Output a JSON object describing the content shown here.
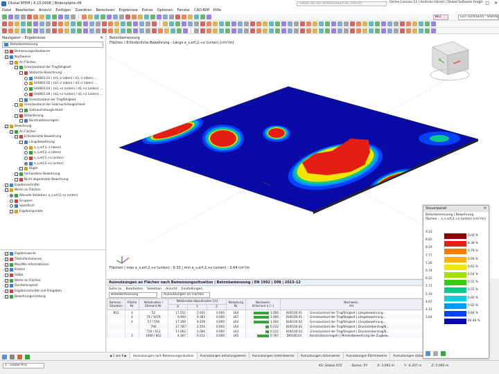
{
  "titlebar": {
    "title": "Dlubal RFEM | 6.15.0008 | Bodenplatte.rf6",
    "search_placeholder": "Geben Sie ein Schlüsselwort ein (Alt+Q)",
    "license": "Online License 12 | Andreas Hörold | Dlubal Software GmbH",
    "min": "–",
    "max": "□",
    "close": "✕"
  },
  "menu": [
    "Datei",
    "Bearbeiten",
    "Ansicht",
    "Einfügen",
    "Zuordnen",
    "Berechnen",
    "Ergebnisse",
    "Extras",
    "Optionen",
    "Fenster",
    "CAD-BIM",
    "Hilfe"
  ],
  "toolbar": {
    "lc_code": "BE1",
    "lc_combo": "GZT (STR/GEO) - Ständig und v...",
    "axis_combo": "1 - Global XYZ"
  },
  "navigator": {
    "title": "Navigator - Ergebnisse",
    "combo": "Betonbemessung",
    "items": [
      {
        "label": "Bemessungssituationen",
        "level": 0,
        "exp": "›",
        "check": "✓"
      },
      {
        "label": "Nachweise",
        "level": 0,
        "exp": "⌄",
        "check": "✓"
      },
      {
        "label": "An Flächen",
        "level": 1,
        "exp": "⌄",
        "check": "✓"
      },
      {
        "label": "Grenzzustand der Tragfähigkeit",
        "level": 2,
        "exp": "⌄",
        "check": ""
      },
      {
        "label": "Statische Berechnung",
        "level": 3,
        "exp": "⌄",
        "check": ""
      },
      {
        "label": "SA0601.01 | (σ1,-z (oben) / σ1,-z (oben) ...",
        "level": 4,
        "radio": true
      },
      {
        "label": "SA0601.02 | (σ2,-z (oben) / σ2,-z (oben) ...",
        "level": 4,
        "radio": true
      },
      {
        "label": "SA0601.03 | (σ1,+z (unten) / σ1,+z (unten) ...",
        "level": 4,
        "radio": true
      },
      {
        "label": "SA0601.04 | (σ2,+z (unten) / σ2,+z (unten) ...",
        "level": 4,
        "radio": true
      },
      {
        "label": "Grenzzustand der Tragfähigkeit",
        "level": 3,
        "exp": "›",
        "check": ""
      },
      {
        "label": "Grenzzustand der Gebrauchstauglichkeit",
        "level": 2,
        "exp": "⌄",
        "check": ""
      },
      {
        "label": "Gebrauchstauglichkeit",
        "level": 3,
        "exp": "›",
        "check": ""
      },
      {
        "label": "Detaillierung",
        "level": 2,
        "exp": "⌄",
        "check": ""
      },
      {
        "label": "Konstruktionsregeln",
        "level": 3,
        "exp": "",
        "check": ""
      },
      {
        "label": "Bewehrung",
        "level": 0,
        "exp": "⌄",
        "check": "✓"
      },
      {
        "label": "An Flächen",
        "level": 1,
        "exp": "⌄",
        "check": "✓"
      },
      {
        "label": "Erforderliche Bewehrung",
        "level": 2,
        "exp": "⌄",
        "check": "✓"
      },
      {
        "label": "Längsbewehrung",
        "level": 3,
        "exp": "⌄",
        "check": ""
      },
      {
        "label": "a_s,erf,1,-z (oben)",
        "level": 4,
        "radio": true
      },
      {
        "label": "a_s,erf,2,-z (oben)",
        "level": 4,
        "radio": true
      },
      {
        "label": "a_s,erf,1,+z (unten)",
        "level": 4,
        "radio": true
      },
      {
        "label": "a_s,erf,2,+z (unten)",
        "level": 4,
        "radio": true,
        "on": true
      },
      {
        "label": "Bügel",
        "level": 3,
        "exp": "›",
        "check": ""
      },
      {
        "label": "Vorhandene Bewehrung",
        "level": 2,
        "exp": "›",
        "check": ""
      },
      {
        "label": "Nicht abgedeckte Bewehrung",
        "level": 2,
        "exp": "›",
        "check": ""
      },
      {
        "label": "Ergebnisschnitte",
        "level": 0,
        "exp": "›",
        "check": ""
      },
      {
        "label": "Werte an Flächen",
        "level": 0,
        "exp": "⌄",
        "check": "✓"
      },
      {
        "label": "Aktuelle Selektion: a_s,erf,2,+z (unten)",
        "level": 1,
        "exp": "›",
        "radio": true,
        "on": true
      },
      {
        "label": "Gruppen",
        "level": 1,
        "exp": "›",
        "radio": true
      },
      {
        "label": "Spezifisch",
        "level": 1,
        "exp": "›",
        "radio": true
      },
      {
        "label": "Ergebnispunkte",
        "level": 1,
        "exp": "",
        "check": ""
      }
    ],
    "lower_items": [
      {
        "label": "Ergebniswerte",
        "check": "✓"
      },
      {
        "label": "Titelinformationen",
        "check": "✓"
      },
      {
        "label": "Max/Min-Informationen",
        "check": "✓"
      },
      {
        "label": "Knoten",
        "check": "✓"
      },
      {
        "label": "Stäbe",
        "check": ""
      },
      {
        "label": "Werte an Flächen",
        "check": "✓"
      },
      {
        "label": "Darstellungsart",
        "check": "✓"
      },
      {
        "label": "Ergebnisschnitte und Freigaben",
        "check": "✓"
      },
      {
        "label": "Bewehrungsrichtung",
        "check": "✓"
      }
    ]
  },
  "viewport": {
    "head1": "Betonbemessung",
    "head2": "Flächen | Erforderliche Bewehrung - Längs a_s,erf,2,+z (unten) [cm²/m]",
    "foot": "Flächen | max a_s,erf,2,+z (unten) : 9.33 | min a_s,erf,2,+z (unten) : 3.64 cm²/m",
    "cube_label": "-Y"
  },
  "results": {
    "title": "Ausnutzungen an Flächen nach Bemessungssituation | Betonbemessung | EN 1992 | DIN | 2015-12",
    "menu": [
      "Gehe zu",
      "Bearbeiten",
      "Selektion",
      "Ansicht",
      "Einstellungen"
    ],
    "combo1": "Betonbemessung",
    "combo2": "Ausnutzungen an Flächen",
    "headers": [
      "Bemess.-\nSituation",
      "Fläche\nNr.",
      "Netzknoten /\nElement Nr.",
      "X",
      "Y",
      "Z",
      "Belastung\nNr.",
      "Nachweis-\nKriterium η [--]",
      "Nachweis-\nArt",
      ""
    ],
    "group_header": "Netzknoten-Koordinaten [m]",
    "rows": [
      [
        "BS1",
        "4",
        "52",
        "17.552",
        "2.005",
        "0.000",
        "LK4",
        "1.000",
        "BU0100.01",
        "Grenzzustand der Tragfähigkeit | Längsbewehrung..."
      ],
      [
        "",
        "4",
        "74 / 1079",
        "0.400",
        "9.383",
        "0.000",
        "LK7",
        "1.000",
        "BU0100.01",
        "Grenzzustand der Tragfähigkeit | Längsbewehrung..."
      ],
      [
        "",
        "4",
        "57 / 556",
        "17.300",
        "9.259",
        "0.000",
        "LK4",
        "1.000",
        "BU0100.02",
        "Grenzzustand der Tragfähigkeit | Längsbewehrung..."
      ],
      [
        "",
        "",
        "790",
        "17.787",
        "2.554",
        "0.000",
        "LK3",
        "0.232",
        "BU0100.01",
        "Grenzzustand der Tragfähigkeit | Druckstrebentragfä..."
      ],
      [
        "",
        "",
        "720 / 613",
        "17.062",
        "2.066",
        "0.000",
        "LK3",
        "0.222",
        "BU0100.02",
        "Grenzzustand der Tragfähigkeit | Druckstrebentragfä..."
      ],
      [
        "",
        "3",
        "1000 / 852",
        "4.307",
        "0.212",
        "0.000",
        "LK5",
        "0.767",
        "DI0100.01",
        "Konstruktionsregeln | Mindestbewehrung der Zugbew..."
      ]
    ],
    "pager": "1 von 6",
    "tabs": [
      "Ausnutzungen nach Bemessungssituation",
      "Ausnutzungen belastungsweise",
      "Ausnutzungen materialweise",
      "Ausnutzungen dickenweise",
      "Ausnutzungen flächenweise",
      "Ausnutzungen stabweise"
    ]
  },
  "control_panel": {
    "title": "Steuerpanel",
    "sub": "Betonbemessung | Bewehrung flächen... a_s,erf,2,+z (unten) [cm²/m]",
    "legend": [
      {
        "value": "9.33",
        "color": "#8b0000",
        "pct": "0.00 %"
      },
      {
        "value": "8.81",
        "color": "#e41e12",
        "pct": "8.38 %"
      },
      {
        "value": "8.29",
        "color": "#ff7a00",
        "pct": "0.78 %"
      },
      {
        "value": "7.77",
        "color": "#ffb000",
        "pct": "0.69 %"
      },
      {
        "value": "7.26",
        "color": "#f2e600",
        "pct": "0.61 %"
      },
      {
        "value": "6.74",
        "color": "#a6e000",
        "pct": "0.64 %"
      },
      {
        "value": "6.22",
        "color": "#36cc1a",
        "pct": "0.55 %"
      },
      {
        "value": "5.71",
        "color": "#0cc88a",
        "pct": "0.55 %"
      },
      {
        "value": "5.19",
        "color": "#00d2d6",
        "pct": "0.60 %"
      },
      {
        "value": "4.67",
        "color": "#009aff",
        "pct": "0.92 %"
      },
      {
        "value": "4.15",
        "color": "#0044ff",
        "pct": "0.84 %"
      },
      {
        "value": "3.64",
        "color": "#0a0aa6",
        "pct": "84.46 %"
      }
    ]
  },
  "status": {
    "cs": "KS: Global XYZ",
    "plane": "Ebene: XY",
    "x": "X: 3.092 m",
    "y": "Y: -4.207 m",
    "z": "Z: 0.000 m"
  }
}
